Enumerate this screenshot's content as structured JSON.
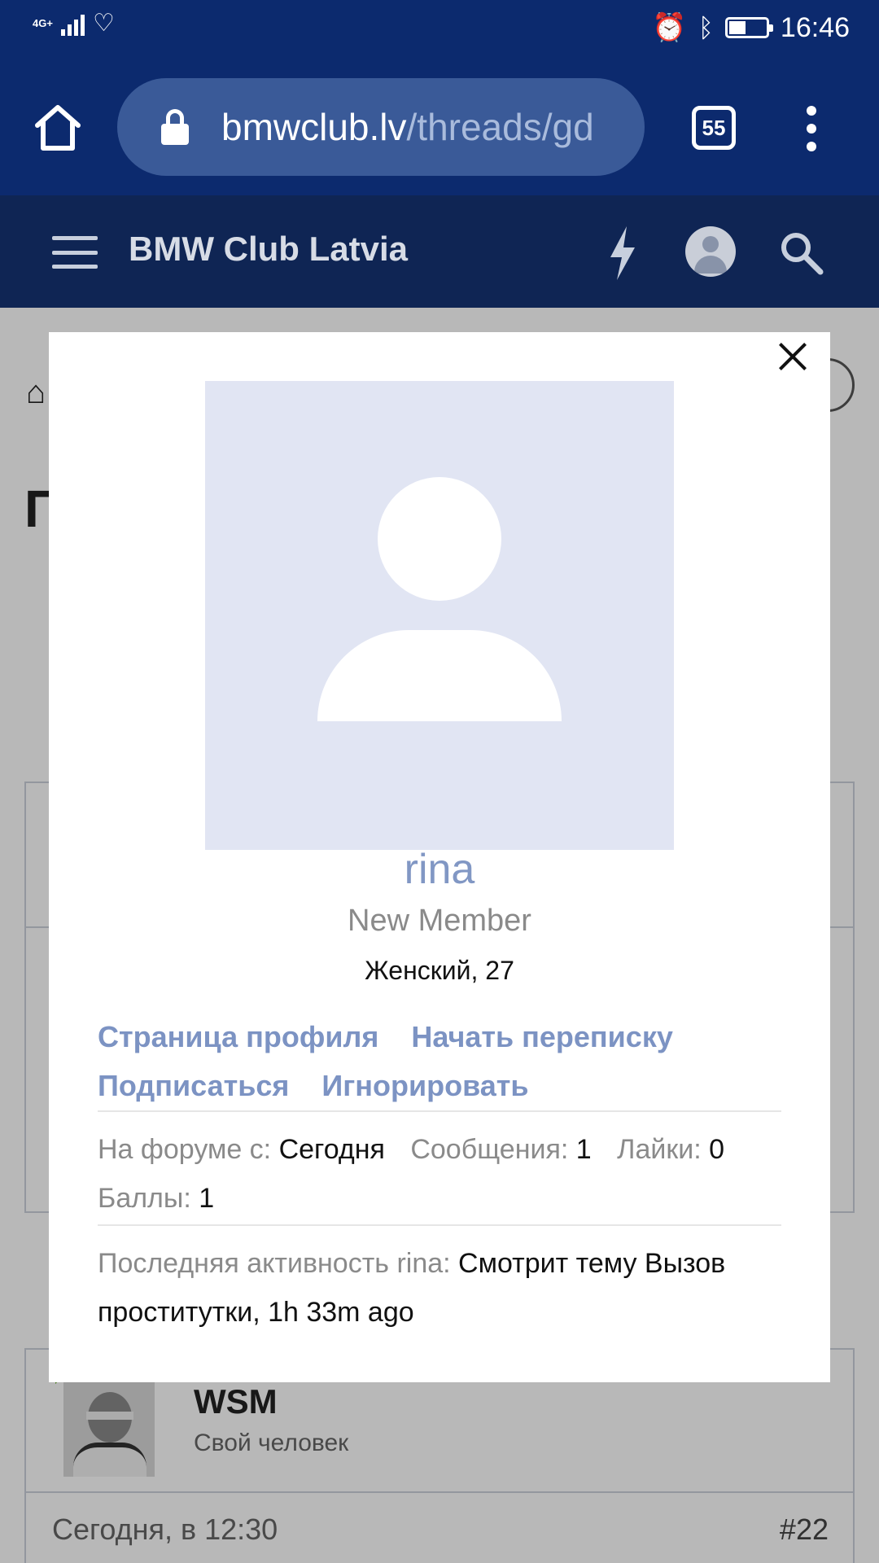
{
  "status_bar": {
    "network": "4G+",
    "time": "16:46",
    "battery_level": 0.45
  },
  "browser": {
    "url_domain": "bmwclub.lv",
    "url_path": "/threads/gd",
    "tab_count": "55"
  },
  "site": {
    "title": "BMW Club Latvia"
  },
  "background": {
    "heading_fragment": "П",
    "post": {
      "author": "WSM",
      "author_role": "Свой человек",
      "date": "Сегодня, в 12:30",
      "number": "#22"
    }
  },
  "profile_popup": {
    "username": "rina",
    "role": "New Member",
    "gender_age": "Женский, 27",
    "links": {
      "profile": "Страница профиля",
      "start_conversation": "Начать переписку",
      "follow": "Подписаться",
      "ignore": "Игнорировать"
    },
    "stats": {
      "joined_label": "На форуме с:",
      "joined_value": "Сегодня",
      "messages_label": "Сообщения:",
      "messages_value": "1",
      "likes_label": "Лайки:",
      "likes_value": "0",
      "points_label": "Баллы:",
      "points_value": "1"
    },
    "last_activity": {
      "label": "Последняя активность rina:",
      "value": "Смотрит тему Вызов проститутки, 1h 33m ago"
    }
  },
  "colors": {
    "browser_bar": "#0c2a6e",
    "site_header": "#0f2554",
    "link": "#7c93c3",
    "username": "#8197c4",
    "avatar_bg": "#e1e5f3"
  }
}
